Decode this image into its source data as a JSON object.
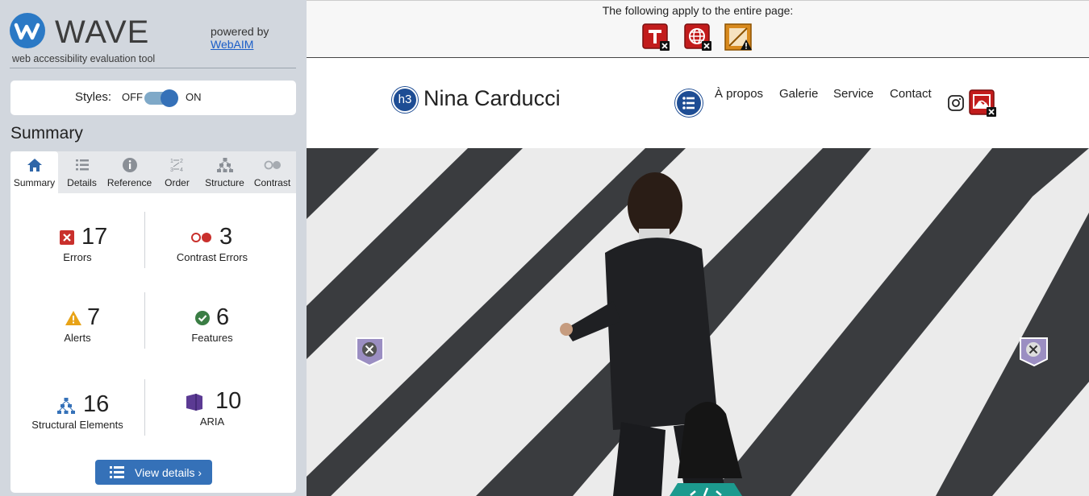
{
  "wave": {
    "logo_text": "WAVE",
    "subtitle": "web accessibility evaluation tool",
    "powered_by": "powered by",
    "webaim_link": "WebAIM",
    "styles_label": "Styles:",
    "styles_off": "OFF",
    "styles_on": "ON",
    "styles_state": "on",
    "summary_title": "Summary",
    "tabs": [
      {
        "label": "Summary",
        "icon": "home-icon",
        "active": true
      },
      {
        "label": "Details",
        "icon": "list-icon",
        "active": false
      },
      {
        "label": "Reference",
        "icon": "info-icon",
        "active": false
      },
      {
        "label": "Order",
        "icon": "order-icon",
        "active": false
      },
      {
        "label": "Structure",
        "icon": "structure-icon",
        "active": false
      },
      {
        "label": "Contrast",
        "icon": "contrast-icon",
        "active": false
      }
    ],
    "stats": {
      "errors": {
        "count": "17",
        "label": "Errors",
        "color": "#c9302c"
      },
      "contrast_errors": {
        "count": "3",
        "label": "Contrast Errors",
        "color": "#c9302c"
      },
      "alerts": {
        "count": "7",
        "label": "Alerts",
        "color": "#e8a317"
      },
      "features": {
        "count": "6",
        "label": "Features",
        "color": "#3a7d44"
      },
      "structural": {
        "count": "16",
        "label": "Structural Elements",
        "color": "#3571b8"
      },
      "aria": {
        "count": "10",
        "label": "ARIA",
        "color": "#5b3a93"
      }
    },
    "view_details": "View details ›"
  },
  "page": {
    "apply_text": "The following apply to the entire page:",
    "page_icons": [
      "title-error-icon",
      "language-error-icon",
      "alert-icon"
    ],
    "h3_badge": "h3",
    "site_title": "Nina Carducci",
    "nav": [
      "À propos",
      "Galerie",
      "Service",
      "Contact"
    ],
    "social_icon": "instagram-icon"
  },
  "colors": {
    "sidebar_bg": "#d2d7de",
    "accent_blue": "#3571b8",
    "error_red": "#c9302c"
  }
}
